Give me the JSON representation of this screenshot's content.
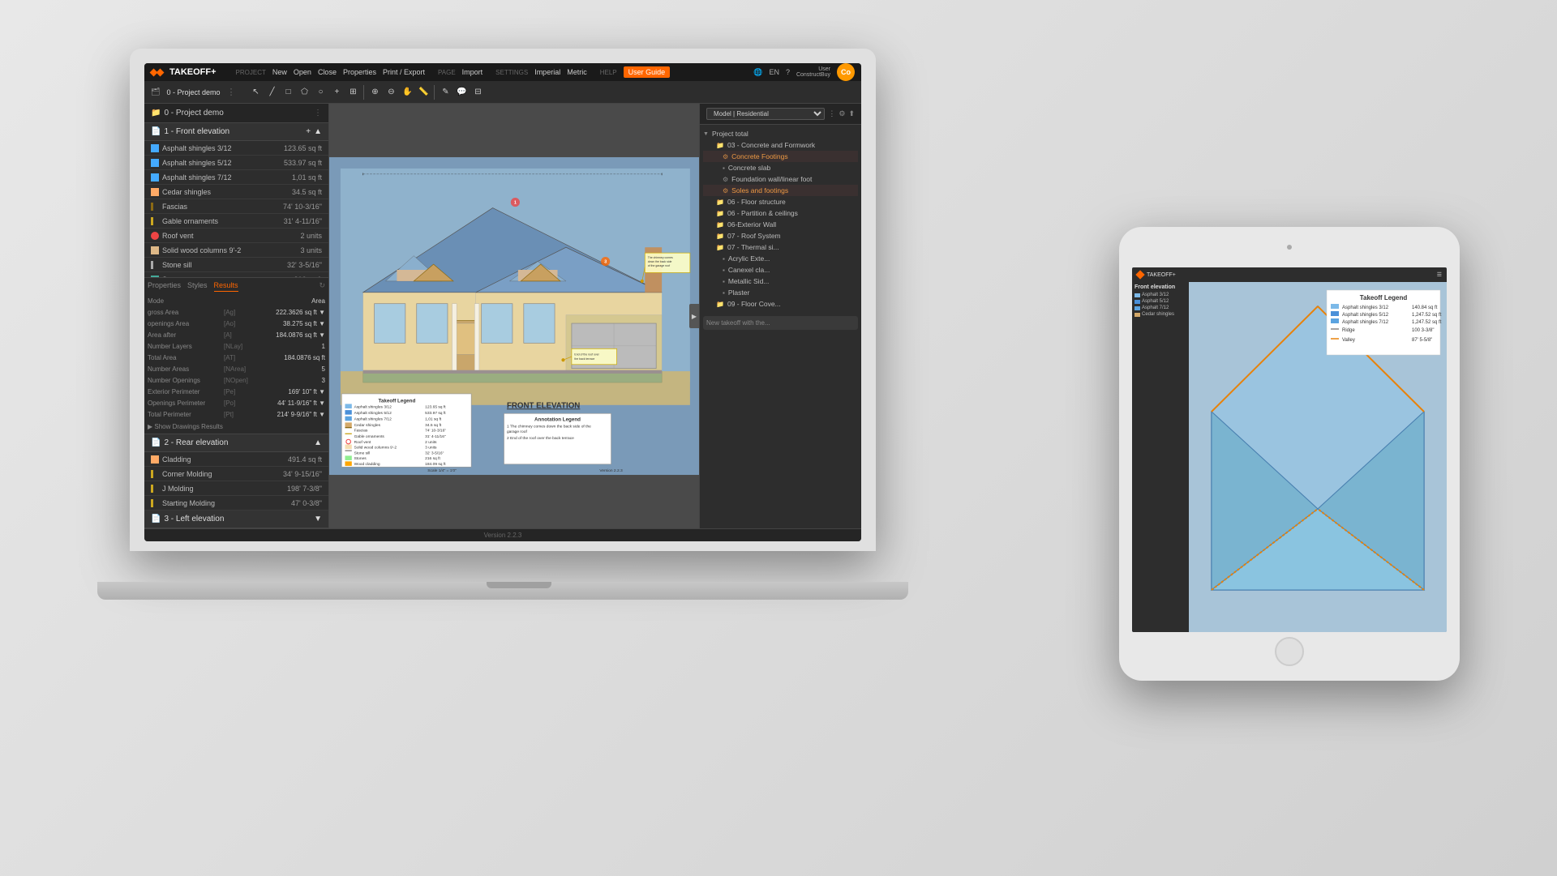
{
  "app": {
    "title": "TAKEOFF+",
    "logo_symbol": "◆◆"
  },
  "menu": {
    "groups": [
      {
        "label": "PROJECT",
        "items": [
          "New",
          "Open",
          "Close",
          "Properties",
          "Print / Export"
        ]
      },
      {
        "label": "PAGE",
        "items": [
          "Import"
        ]
      },
      {
        "label": "SETTINGS",
        "items": [
          "Imperial",
          "Metric"
        ]
      },
      {
        "label": "HELP",
        "items": [
          "User Guide"
        ]
      }
    ],
    "active_item": "User Guide"
  },
  "toolbar": {
    "buttons": [
      "New",
      "Open",
      "Close",
      "Properties",
      "Print / Export",
      "Import",
      "Imperial",
      "Metric",
      "User Guide"
    ]
  },
  "project": {
    "name": "0 - Project demo"
  },
  "left_panel": {
    "section1": {
      "title": "1 - Front elevation",
      "items": [
        {
          "name": "Asphalt shingles 3/12",
          "value": "123.65 sq ft",
          "color": "blue"
        },
        {
          "name": "Asphalt shingles 5/12",
          "value": "533.97 sq ft",
          "color": "blue"
        },
        {
          "name": "Asphalt shingles 7/12",
          "value": "1.01 sq ft",
          "color": "blue"
        },
        {
          "name": "Cedar shingles",
          "value": "34.5 sq ft",
          "color": "orange"
        },
        {
          "name": "Fascias",
          "value": "74' 10-3/16\"",
          "color": "orange"
        },
        {
          "name": "Gable ornaments",
          "value": "31' 4-11/16\"",
          "color": "orange"
        },
        {
          "name": "Roof vent",
          "value": "2 units",
          "color": "red"
        },
        {
          "name": "Solid wood columns 9'-2",
          "value": "3 units",
          "color": "orange"
        },
        {
          "name": "Stone sill",
          "value": "32' 3-5/16\"",
          "color": "orange"
        },
        {
          "name": "Stones",
          "value": "216 sq ft",
          "color": "green"
        },
        {
          "name": "Wood cladding",
          "value": "184.09 sq ft",
          "color": "orange",
          "selected": true
        }
      ]
    },
    "properties_tabs": [
      "Properties",
      "Styles",
      "Results"
    ],
    "active_tab": "Results",
    "properties": [
      {
        "label": "Mode",
        "code": "",
        "value": "Area"
      },
      {
        "label": "gross Area",
        "code": "[Ag]",
        "value": "222.3626 sq ft ▼"
      },
      {
        "label": "openings Area",
        "code": "[Ao]",
        "value": "38.275 sq ft ▼"
      },
      {
        "label": "Area after",
        "code": "[A]",
        "value": "184.0876 sq ft ▼"
      },
      {
        "label": "Number Layers",
        "code": "[NLay]",
        "value": "1"
      },
      {
        "label": "Total Area",
        "code": "[AT]",
        "value": "184.0876 sq ft"
      },
      {
        "label": "Number Areas",
        "code": "[NArea]",
        "value": "5"
      },
      {
        "label": "Number Openings",
        "code": "[NOpen]",
        "value": "3"
      },
      {
        "label": "Exterior Perimeter",
        "code": "[Pe]",
        "value": "169' 10\" ft ▼"
      },
      {
        "label": "Openings Perimeter",
        "code": "[Po]",
        "value": "44' 11-9/16\" ft ▼"
      },
      {
        "label": "Total Perimeter",
        "code": "[Pt]",
        "value": "214' 9-9/16\" ft ▼"
      }
    ],
    "show_drawings": "Show Drawings Results",
    "section2": {
      "title": "2 - Rear elevation",
      "items": [
        {
          "name": "Cladding",
          "value": "491.4 sq ft",
          "color": "orange"
        },
        {
          "name": "Corner Molding",
          "value": "34' 9-15/16\"",
          "color": "orange"
        },
        {
          "name": "J Molding",
          "value": "198' 7-3/8\"",
          "color": "orange"
        },
        {
          "name": "Starting Molding",
          "value": "47' 0-3/8\"",
          "color": "orange"
        }
      ]
    },
    "section3_title": "3 - Left elevation"
  },
  "canvas": {
    "blueprint_title": "FRONT ELEVATION",
    "legend_title": "Takeoff Legend",
    "legend_items": [
      {
        "label": "Asphalt shingles 3/12",
        "value": "123.65 sq ft",
        "color": "#7cb9e8"
      },
      {
        "label": "Asphalt shingles 5/12",
        "value": "533.97 sq ft",
        "color": "#4a90d9"
      },
      {
        "label": "Asphalt shingles 7/12",
        "value": "1.01 sq ft",
        "color": "#5ba3e0"
      },
      {
        "label": "Cedar shingles",
        "value": "34.5 sq ft",
        "color": "#d4a96a"
      },
      {
        "label": "Fascias",
        "value": "74' 10-3/16\"",
        "color": "#8b6914"
      },
      {
        "label": "Gable ornaments",
        "value": "31' 4-11/16\"",
        "color": "#8b6914"
      },
      {
        "label": "Roof vent",
        "value": "2 units",
        "color": "#fff"
      },
      {
        "label": "Solid wood columns 9'-2",
        "value": "3 units",
        "color": "#f5deb3"
      },
      {
        "label": "Stone sill",
        "value": "32' 3-5/16\"",
        "color": "#8b8682"
      },
      {
        "label": "Stones",
        "value": "216 sq ft",
        "color": "#90ee90"
      },
      {
        "label": "Wood cladding",
        "value": "184.09 sq ft",
        "color": "#ffa500"
      }
    ],
    "annotation_legend_title": "Annotation Legend",
    "annotations": [
      "The chimney comes down the back side of the garage roof",
      "End of the roof over the back terrace"
    ],
    "callouts": [
      "The chimney comes down the back side of the garage roof",
      "End of the roof over the back terrace"
    ],
    "scale": "Scale 1/4\" = 1'0\"",
    "version": "Version 2.2.3"
  },
  "right_panel": {
    "model_label": "Model | Residential",
    "project_total": "Project total",
    "tree_items": [
      {
        "label": "03 - Concrete and Formwork",
        "level": 1,
        "type": "folder"
      },
      {
        "label": "Concrete Footings",
        "level": 2,
        "type": "item",
        "highlighted": true
      },
      {
        "label": "Concrete slab",
        "level": 2,
        "type": "item"
      },
      {
        "label": "Foundation wall/linear foot",
        "level": 2,
        "type": "item"
      },
      {
        "label": "Soles and footings",
        "level": 2,
        "type": "item",
        "highlighted": true
      },
      {
        "label": "06 - Floor structure",
        "level": 1,
        "type": "folder"
      },
      {
        "label": "06 - Partition & ceilings",
        "level": 1,
        "type": "folder"
      },
      {
        "label": "06-Exterior Wall",
        "level": 1,
        "type": "folder"
      },
      {
        "label": "07 - Roof System",
        "level": 1,
        "type": "folder"
      },
      {
        "label": "07 - Thermal si...",
        "level": 1,
        "type": "folder"
      },
      {
        "label": "Acrylic Exte...",
        "level": 2,
        "type": "item"
      },
      {
        "label": "Canexel cla...",
        "level": 2,
        "type": "item"
      },
      {
        "label": "Metallic Sid...",
        "level": 2,
        "type": "item"
      },
      {
        "label": "Plaster",
        "level": 2,
        "type": "item"
      },
      {
        "label": "09 - Floor Cove...",
        "level": 1,
        "type": "folder"
      }
    ],
    "new_takeoff_placeholder": "New takeoff with the..."
  },
  "tablet": {
    "legend_title": "Takeoff Legend",
    "legend_items": [
      {
        "label": "Asphalt shingles 3/12",
        "value": "140.84 sq ft"
      },
      {
        "label": "Asphalt shingles 5/12",
        "value": "1,247.52 sq ft"
      },
      {
        "label": "Asphalt shingles 7/12",
        "value": "1,247.52 sq ft"
      },
      {
        "label": "Ridge",
        "value": "100 3-3/8\""
      },
      {
        "label": "Valley",
        "value": "87' 5-5/8\""
      }
    ]
  },
  "user": {
    "label": "User",
    "company": "ConstructBuy",
    "initials": "Co"
  },
  "icons": {
    "folder": "📁",
    "chevron_right": "▶",
    "chevron_down": "▼",
    "chevron_up": "▲",
    "plus": "+",
    "settings": "⚙",
    "globe": "🌐",
    "question": "?",
    "menu_dots": "⋮"
  }
}
